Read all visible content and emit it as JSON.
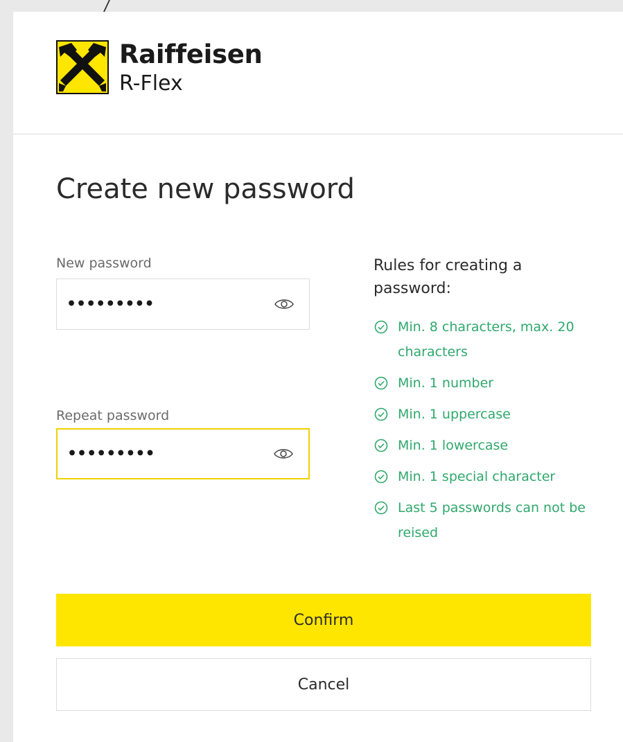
{
  "top_fragment": "/",
  "brand": {
    "name": "Raiffeisen",
    "product": "R-Flex",
    "logo_icon": "raiffeisen-crossed-horses-icon",
    "logo_color": "#ffe600"
  },
  "page_title": "Create new password",
  "form": {
    "new_password": {
      "label": "New password",
      "value": "•••••••••",
      "toggle_icon": "eye-icon"
    },
    "repeat_password": {
      "label": "Repeat password",
      "value": "•••••••••",
      "toggle_icon": "eye-icon",
      "focused_border_color": "#f0d000"
    }
  },
  "rules": {
    "title": "Rules for creating a password:",
    "status_color": "#2fa86c",
    "status_icon": "check-circle-icon",
    "items": [
      "Min. 8 characters, max. 20 characters",
      "Min. 1 number",
      "Min. 1 uppercase",
      "Min. 1 lowercase",
      "Min. 1 special character",
      "Last 5 passwords can not be reised"
    ]
  },
  "actions": {
    "confirm_label": "Confirm",
    "cancel_label": "Cancel",
    "confirm_color": "#ffe600"
  }
}
